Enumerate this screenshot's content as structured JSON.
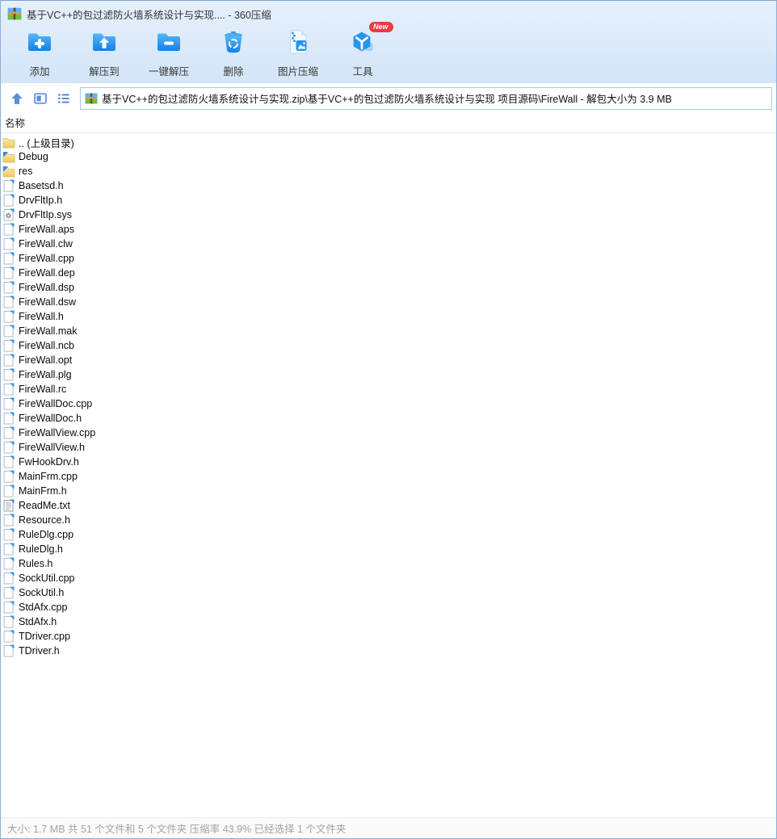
{
  "window": {
    "title": "基于VC++的包过滤防火墙系统设计与实现.... - 360压缩"
  },
  "toolbar": {
    "buttons": [
      {
        "label": "添加",
        "icon": "add-archive-icon"
      },
      {
        "label": "解压到",
        "icon": "extract-to-icon"
      },
      {
        "label": "一键解压",
        "icon": "one-click-extract-icon"
      },
      {
        "label": "删除",
        "icon": "delete-icon"
      },
      {
        "label": "图片压缩",
        "icon": "image-compress-icon"
      },
      {
        "label": "工具",
        "icon": "tools-icon",
        "badge": "New"
      }
    ]
  },
  "addressbar": {
    "path": "基于VC++的包过滤防火墙系统设计与实现.zip\\基于VC++的包过滤防火墙系统设计与实现 项目源码\\FireWall - 解包大小为 3.9 MB"
  },
  "filelist": {
    "name_column_header": "名称",
    "items": [
      {
        "name": ".. (上级目录)",
        "type": "parent",
        "icon": "parent-folder-icon"
      },
      {
        "name": "Debug",
        "type": "folder",
        "icon": "folder-icon"
      },
      {
        "name": "res",
        "type": "folder",
        "icon": "folder-icon"
      },
      {
        "name": "Basetsd.h",
        "type": "file",
        "icon": "file-icon"
      },
      {
        "name": "DrvFltIp.h",
        "type": "file",
        "icon": "file-icon"
      },
      {
        "name": "DrvFltIp.sys",
        "type": "sys",
        "icon": "system-file-icon"
      },
      {
        "name": "FireWall.aps",
        "type": "file",
        "icon": "file-icon"
      },
      {
        "name": "FireWall.clw",
        "type": "file",
        "icon": "file-icon"
      },
      {
        "name": "FireWall.cpp",
        "type": "file",
        "icon": "file-icon"
      },
      {
        "name": "FireWall.dep",
        "type": "file",
        "icon": "file-icon"
      },
      {
        "name": "FireWall.dsp",
        "type": "file",
        "icon": "file-icon"
      },
      {
        "name": "FireWall.dsw",
        "type": "file",
        "icon": "file-icon"
      },
      {
        "name": "FireWall.h",
        "type": "file",
        "icon": "file-icon"
      },
      {
        "name": "FireWall.mak",
        "type": "file",
        "icon": "file-icon"
      },
      {
        "name": "FireWall.ncb",
        "type": "file",
        "icon": "file-icon"
      },
      {
        "name": "FireWall.opt",
        "type": "file",
        "icon": "file-icon"
      },
      {
        "name": "FireWall.plg",
        "type": "file",
        "icon": "file-icon"
      },
      {
        "name": "FireWall.rc",
        "type": "file",
        "icon": "file-icon"
      },
      {
        "name": "FireWallDoc.cpp",
        "type": "file",
        "icon": "file-icon"
      },
      {
        "name": "FireWallDoc.h",
        "type": "file",
        "icon": "file-icon"
      },
      {
        "name": "FireWallView.cpp",
        "type": "file",
        "icon": "file-icon"
      },
      {
        "name": "FireWallView.h",
        "type": "file",
        "icon": "file-icon"
      },
      {
        "name": "FwHookDrv.h",
        "type": "file",
        "icon": "file-icon"
      },
      {
        "name": "MainFrm.cpp",
        "type": "file",
        "icon": "file-icon"
      },
      {
        "name": "MainFrm.h",
        "type": "file",
        "icon": "file-icon"
      },
      {
        "name": "ReadMe.txt",
        "type": "txt",
        "icon": "text-file-icon"
      },
      {
        "name": "Resource.h",
        "type": "file",
        "icon": "file-icon"
      },
      {
        "name": "RuleDlg.cpp",
        "type": "file",
        "icon": "file-icon"
      },
      {
        "name": "RuleDlg.h",
        "type": "file",
        "icon": "file-icon"
      },
      {
        "name": "Rules.h",
        "type": "file",
        "icon": "file-icon"
      },
      {
        "name": "SockUtil.cpp",
        "type": "file",
        "icon": "file-icon"
      },
      {
        "name": "SockUtil.h",
        "type": "file",
        "icon": "file-icon"
      },
      {
        "name": "StdAfx.cpp",
        "type": "file",
        "icon": "file-icon"
      },
      {
        "name": "StdAfx.h",
        "type": "file",
        "icon": "file-icon"
      },
      {
        "name": "TDriver.cpp",
        "type": "file",
        "icon": "file-icon"
      },
      {
        "name": "TDriver.h",
        "type": "file",
        "icon": "file-icon"
      }
    ]
  },
  "statusbar": {
    "text": "大小: 1.7 MB 共 51 个文件和 5 个文件夹 压缩率 43.9% 已经选择 1 个文件夹"
  },
  "colors": {
    "chrome_top": "#d6e6f8",
    "toolbar_icon_blue": "#1c87ec",
    "badge_red": "#e93b40",
    "nav_icon_blue": "#5b90d2",
    "status_text": "#a3a3a3"
  }
}
